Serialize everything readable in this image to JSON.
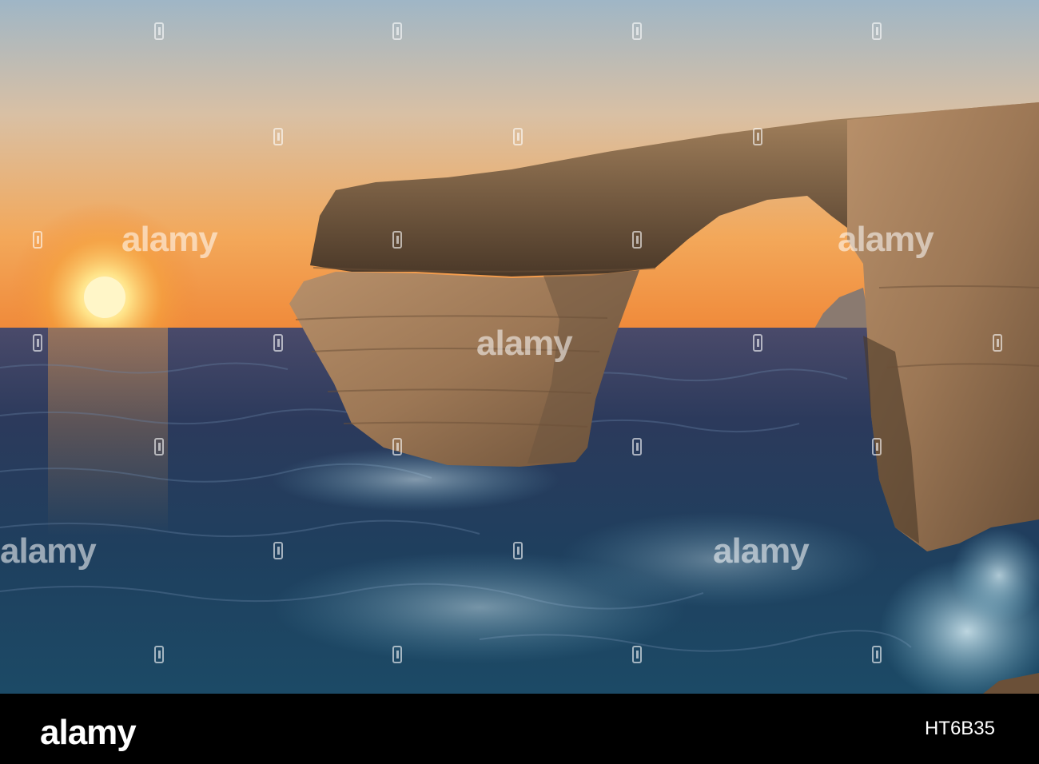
{
  "watermark": {
    "text": "alamy"
  },
  "footer": {
    "logo": "alamy",
    "image_id": "HT6B35"
  },
  "colors": {
    "sky_top": "#9fb4c3",
    "sky_horizon": "#f2a04a",
    "sun": "#fff6c8",
    "sea_dark": "#1f3a57",
    "sea_foam": "#5f9fb8",
    "rock_light": "#b58f69",
    "rock_shadow": "#5e4733",
    "footer_bg": "#000000"
  }
}
